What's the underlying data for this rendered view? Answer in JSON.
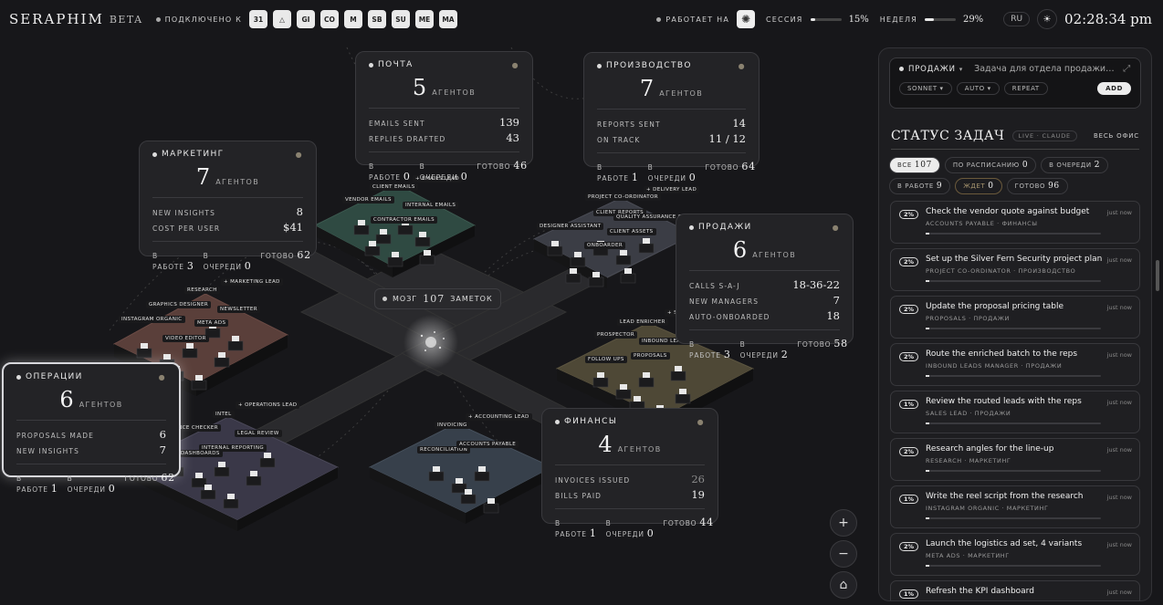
{
  "app": {
    "name": "SERAPHIM",
    "tag": "BETA"
  },
  "topbar": {
    "connected_label": "ПОДКЛЮЧЕНО К",
    "integrations": [
      "31",
      "△",
      "GI",
      "CO",
      "M",
      "SB",
      "SU",
      "ME",
      "MA"
    ],
    "runs_on_label": "РАБОТАЕТ НА",
    "session_label": "СЕССИЯ",
    "session_pct": "15%",
    "session_value": 0.15,
    "week_label": "НЕДЕЛЯ",
    "week_pct": "29%",
    "week_value": 0.29,
    "lang": "RU",
    "theme_glyph": "☀",
    "clock": "02:28:34 pm"
  },
  "brain": {
    "label": "МОЗГ",
    "count": "107",
    "suffix": "ЗАМЕТОК"
  },
  "departments": {
    "mail": {
      "name": "ПОЧТА",
      "count": "5",
      "unit": "АГЕНТОВ",
      "stats": [
        {
          "k": "EMAILS SENT",
          "v": "139"
        },
        {
          "k": "REPLIES DRAFTED",
          "v": "43"
        }
      ],
      "work": "0",
      "queue": "0",
      "done": "46"
    },
    "production": {
      "name": "ПРОИЗВОДСТВО",
      "count": "7",
      "unit": "АГЕНТОВ",
      "stats": [
        {
          "k": "REPORTS SENT",
          "v": "14"
        },
        {
          "k": "ON TRACK",
          "v": "11 / 12"
        }
      ],
      "work": "1",
      "queue": "0",
      "done": "64"
    },
    "marketing": {
      "name": "МАРКЕТИНГ",
      "count": "7",
      "unit": "АГЕНТОВ",
      "stats": [
        {
          "k": "NEW INSIGHTS",
          "v": "8"
        },
        {
          "k": "COST PER USER",
          "v": "$41"
        }
      ],
      "work": "3",
      "queue": "0",
      "done": "62"
    },
    "sales": {
      "name": "ПРОДАЖИ",
      "count": "6",
      "unit": "АГЕНТОВ",
      "stats": [
        {
          "k": "CALLS S-A-J",
          "v": "18-36-22"
        },
        {
          "k": "NEW MANAGERS",
          "v": "7"
        },
        {
          "k": "AUTO-ONBOARDED",
          "v": "18"
        }
      ],
      "work": "3",
      "queue": "2",
      "done": "58"
    },
    "operations": {
      "name": "ОПЕРАЦИИ",
      "count": "6",
      "unit": "АГЕНТОВ",
      "stats": [
        {
          "k": "PROPOSALS MADE",
          "v": "6"
        },
        {
          "k": "NEW INSIGHTS",
          "v": "7"
        }
      ],
      "work": "1",
      "queue": "0",
      "done": "62"
    },
    "finance": {
      "name": "ФИНАНСЫ",
      "count": "4",
      "unit": "АГЕНТОВ",
      "stats": [
        {
          "k": "INVOICES ISSUED",
          "v": "26"
        },
        {
          "k": "BILLS PAID",
          "v": "19"
        }
      ],
      "work": "1",
      "queue": "0",
      "done": "44"
    }
  },
  "status_labels": {
    "work": "В РАБОТЕ",
    "queue": "В ОЧЕРЕДИ",
    "done": "ГОТОВО"
  },
  "agent_labels": [
    "+ EMAILS LEAD",
    "CLIENT EMAILS",
    "VENDOR EMAILS",
    "INTERNAL EMAILS",
    "CONTRACTOR EMAILS",
    "PROJECT CO-ORDINATOR",
    "+ DELIVERY LEAD",
    "CLIENT REPORTS",
    "QUALITY ASSURANCE CHE",
    "DESIGNER ASSISTANT",
    "CLIENT ASSETS",
    "ONBOARDER",
    "RESEARCH",
    "+ MARKETING LEAD",
    "GRAPHICS DESIGNER",
    "NEWSLETTER",
    "INSTAGRAM ORGANIC",
    "META ADS",
    "VIDEO EDITOR",
    "LEAD ENRICHER",
    "+ SA",
    "PROSPECTOR",
    "INBOUND LEADS",
    "PROPOSALS",
    "FOLLOW UPS",
    "INTEL",
    "+ OPERATIONS LEAD",
    "ANCE CHECKER",
    "LEGAL REVIEW",
    "INTERNAL REPORTING",
    "DASHBOARDS",
    "INVOICING",
    "+ ACCOUNTING LEAD",
    "RECONCILIATION",
    "ACCOUNTS PAYABLE"
  ],
  "zoom": {
    "in": "+",
    "out": "−",
    "home": "⌂"
  },
  "composer": {
    "dept": "ПРОДАЖИ",
    "placeholder": "Задача для отдела продажи…",
    "model": "SONNET",
    "mode": "AUTO",
    "repeat": "REPEAT",
    "add": "ADD"
  },
  "tasks_panel": {
    "title": "СТАТУС ЗАДАЧ",
    "live": "LIVE · CLAUDE",
    "all_office": "ВЕСЬ ОФИС",
    "filters": [
      {
        "label": "ВСЕ",
        "count": "107",
        "active": true
      },
      {
        "label": "ПО РАСПИСАНИЮ",
        "count": "0"
      },
      {
        "label": "В ОЧЕРЕДИ",
        "count": "2"
      },
      {
        "label": "В РАБОТЕ",
        "count": "9"
      },
      {
        "label": "ЖДЕТ",
        "count": "0",
        "warn": true
      },
      {
        "label": "ГОТОВО",
        "count": "96"
      }
    ],
    "items": [
      {
        "pct": "2%",
        "title": "Check the vendor quote against budget",
        "meta": "ACCOUNTS PAYABLE · ФИНАНСЫ",
        "when": "just now",
        "progress": 0.02
      },
      {
        "pct": "2%",
        "title": "Set up the Silver Fern Security project plan",
        "meta": "PROJECT CO-ORDINATOR · ПРОИЗВОДСТВО",
        "when": "just now",
        "progress": 0.02
      },
      {
        "pct": "2%",
        "title": "Update the proposal pricing table",
        "meta": "PROPOSALS · ПРОДАЖИ",
        "when": "just now",
        "progress": 0.02
      },
      {
        "pct": "2%",
        "title": "Route the enriched batch to the reps",
        "meta": "INBOUND LEADS MANAGER · ПРОДАЖИ",
        "when": "just now",
        "progress": 0.02
      },
      {
        "pct": "1%",
        "title": "Review the routed leads with the reps",
        "meta": "SALES LEAD · ПРОДАЖИ",
        "when": "just now",
        "progress": 0.01
      },
      {
        "pct": "2%",
        "title": "Research angles for the line-up",
        "meta": "RESEARCH · МАРКЕТИНГ",
        "when": "just now",
        "progress": 0.02
      },
      {
        "pct": "1%",
        "title": "Write the reel script from the research",
        "meta": "INSTAGRAM ORGANIC · МАРКЕТИНГ",
        "when": "just now",
        "progress": 0.01
      },
      {
        "pct": "2%",
        "title": "Launch the logistics ad set, 4 variants",
        "meta": "META ADS · МАРКЕТИНГ",
        "when": "just now",
        "progress": 0.02
      },
      {
        "pct": "1%",
        "title": "Refresh the KPI dashboard",
        "meta": "",
        "when": "just now",
        "progress": 0.01
      }
    ]
  }
}
